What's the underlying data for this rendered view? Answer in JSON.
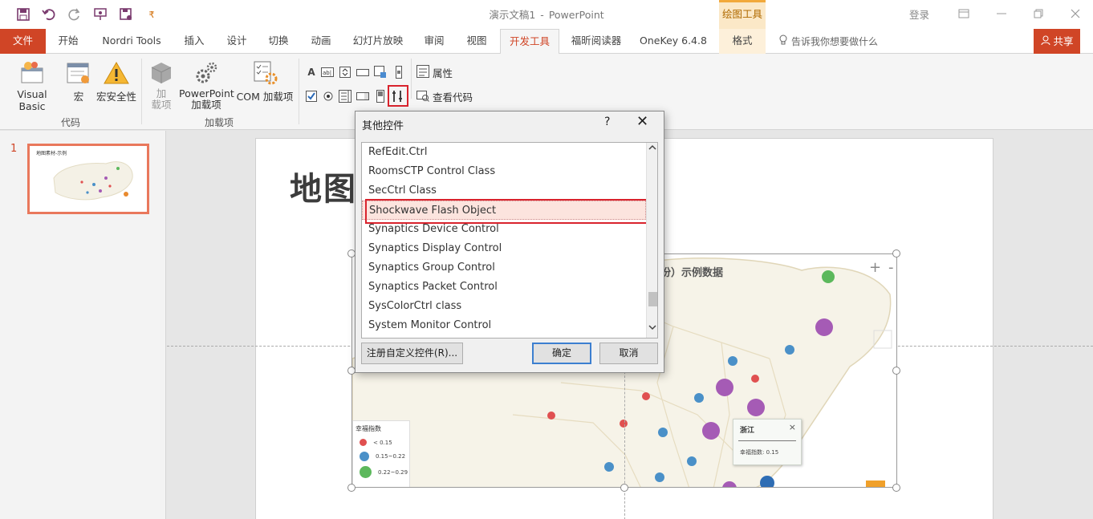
{
  "window": {
    "doc_name": "演示文稿1",
    "dash": "-",
    "app_name": "PowerPoint",
    "context_group": "绘图工具",
    "login": "登录"
  },
  "tabs": {
    "file": "文件",
    "home": "开始",
    "nordri": "Nordri Tools",
    "insert": "插入",
    "design": "设计",
    "transitions": "切换",
    "animations": "动画",
    "slideshow": "幻灯片放映",
    "review": "审阅",
    "view": "视图",
    "developer": "开发工具",
    "foxit": "福昕阅读器",
    "onekey": "OneKey 6.4.8",
    "format": "格式",
    "tellme": "告诉我你想要做什么",
    "share": "共享"
  },
  "ribbon": {
    "visual_basic": "Visual Basic",
    "macros": "宏",
    "macro_security": "宏安全性",
    "addins_line1": "加",
    "addins_line2": "载项",
    "ppt_addins_line1": "PowerPoint",
    "ppt_addins_line2": "加载项",
    "com_addins": "COM 加载项",
    "group_code": "代码",
    "group_addins": "加载项",
    "properties": "属性",
    "view_code": "查看代码"
  },
  "slides_panel": {
    "number": "1",
    "thumb_title": "地图素材-示例"
  },
  "slide": {
    "title": "地图",
    "map_subtitle": "份）示例数据",
    "legend_title": "幸福指数",
    "legend_items": [
      "< 0.15",
      "0.15~0.22",
      "0.22~0.29"
    ],
    "tooltip_title": "浙江",
    "tooltip_value": "幸福指数: 0.15"
  },
  "dialog": {
    "title": "其他控件",
    "help": "?",
    "close": "✕",
    "items": [
      "RefEdit.Ctrl",
      "RoomsCTP Control Class",
      "SecCtrl Class",
      "Shockwave Flash Object",
      "Synaptics Device Control",
      "Synaptics Display Control",
      "Synaptics Group Control",
      "Synaptics Packet Control",
      "SysColorCtrl class",
      "System Monitor Control"
    ],
    "selected_item": "Shockwave Flash Object",
    "register_button": "注册自定义控件(R)...",
    "ok_button": "确定",
    "cancel_button": "取消"
  },
  "colors": {
    "accent": "#d04526",
    "highlight": "#d9232d",
    "red_dot": "#e05050",
    "blue_dot": "#4a90c8",
    "green_dot": "#5cb85c",
    "purple_dot": "#a55bb5"
  }
}
